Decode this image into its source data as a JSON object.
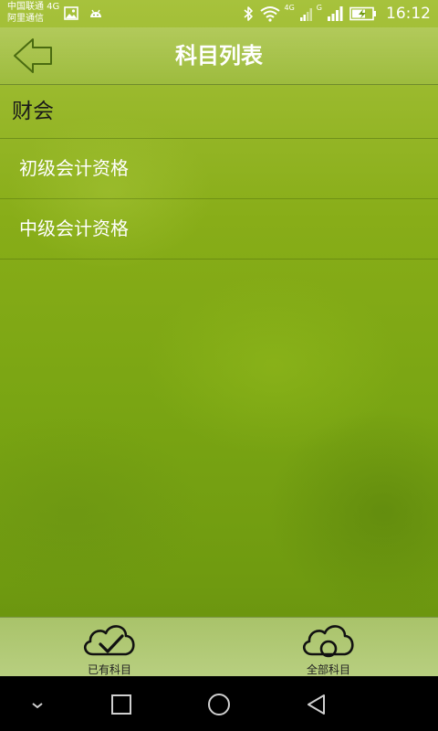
{
  "status_bar": {
    "carrier_line1": "中国联通 4G",
    "carrier_line2": "阿里通信",
    "time": "16:12",
    "net_4g": "4G",
    "net_g": "G",
    "icons": [
      "image-icon",
      "android-icon",
      "bluetooth-icon",
      "wifi-icon",
      "signal-icon",
      "battery-charging-icon"
    ]
  },
  "header": {
    "title": "科目列表",
    "back_icon": "back-arrow-icon"
  },
  "list": {
    "category": "财会",
    "items": [
      {
        "label": "初级会计资格"
      },
      {
        "label": "中级会计资格"
      }
    ]
  },
  "tabs": [
    {
      "label": "已有科目",
      "icon": "cloud-check-icon"
    },
    {
      "label": "全部科目",
      "icon": "cloud-circle-icon"
    }
  ],
  "nav": {
    "icons": [
      "chevron-down-icon",
      "square-icon",
      "circle-icon",
      "triangle-back-icon"
    ]
  },
  "colors": {
    "background": "#7aa513",
    "tab_bar": "#b0c976",
    "nav_bar": "#000000",
    "text_light": "#ffffff",
    "text_dark": "#1a1a1a"
  }
}
